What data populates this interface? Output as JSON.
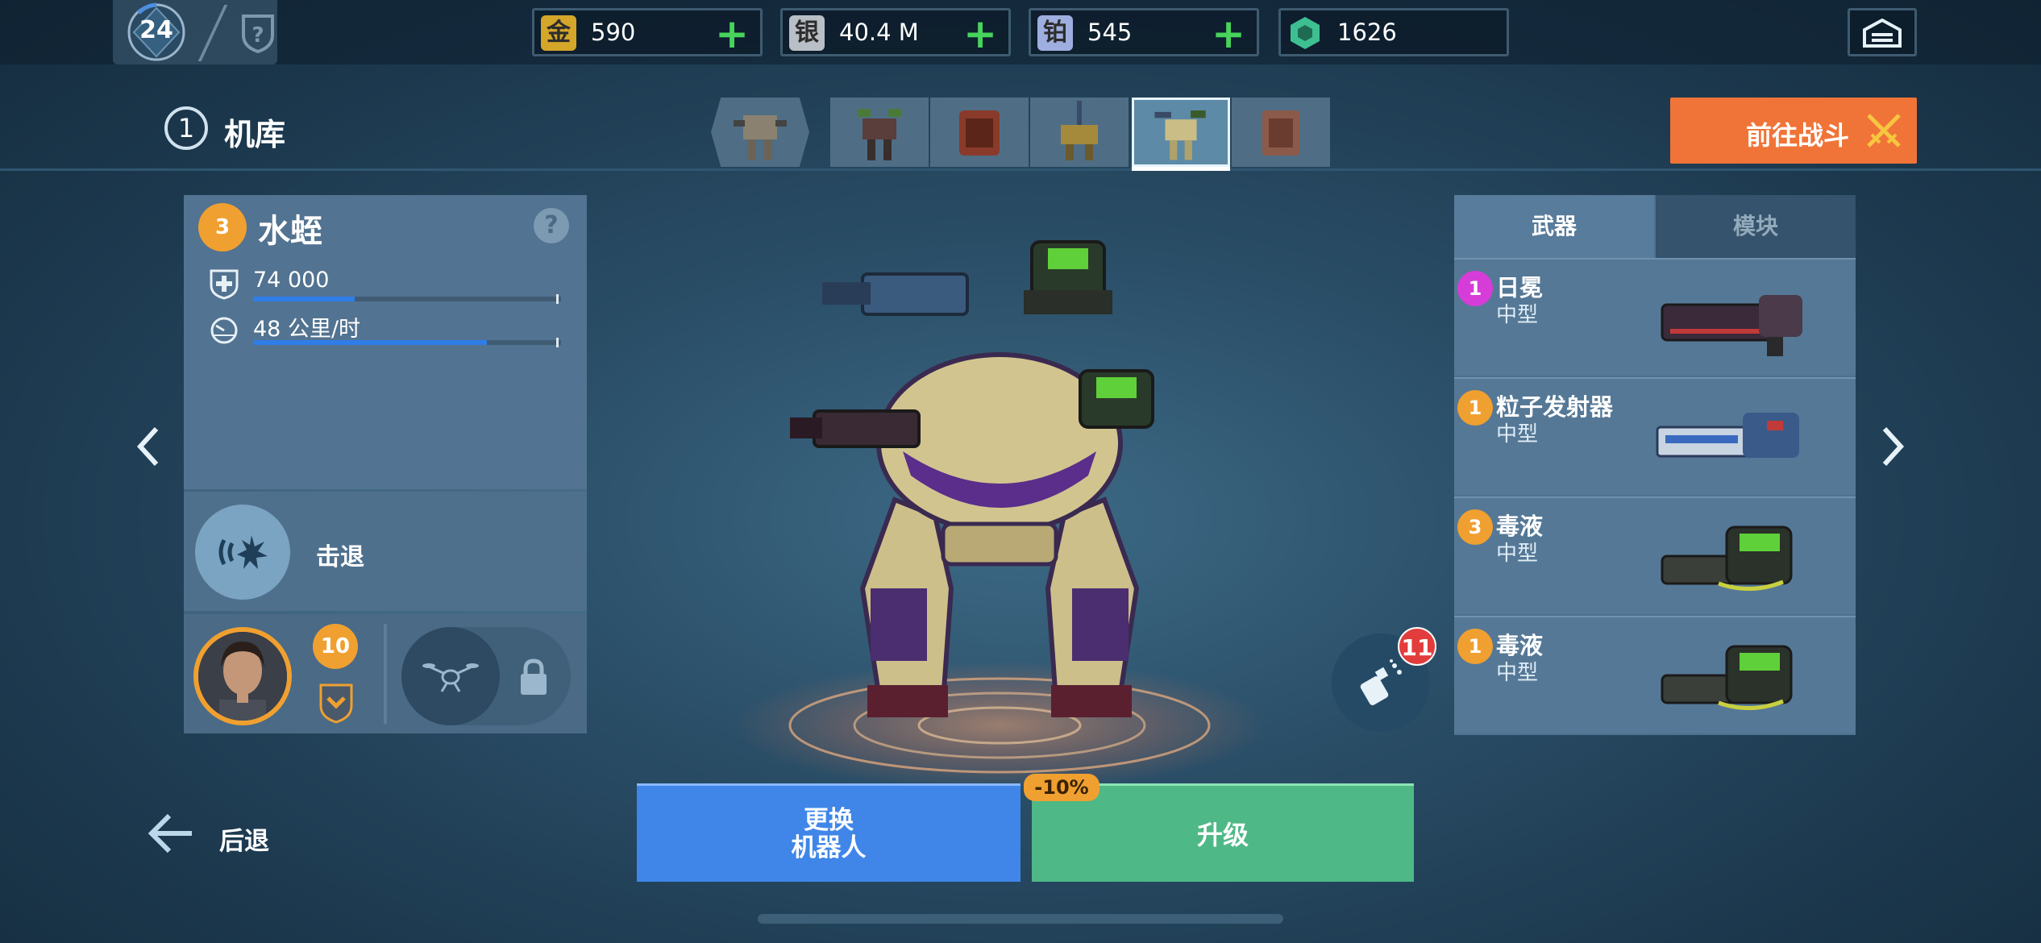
{
  "player": {
    "level": "24"
  },
  "currencies": [
    {
      "name": "gold",
      "glyph": "金",
      "value": "590",
      "color": "#d4a62a"
    },
    {
      "name": "silver",
      "glyph": "银",
      "value": "40.4 M",
      "color": "#b9bfc6"
    },
    {
      "name": "platinum",
      "glyph": "铂",
      "value": "545",
      "color": "#9eaedf"
    },
    {
      "name": "key",
      "glyph": "",
      "value": "1626",
      "color": "#3dbf91"
    }
  ],
  "header": {
    "hangar_number": "1",
    "hangar_title": "机库",
    "go_battle": "前往战斗"
  },
  "robot": {
    "rank": "3",
    "name": "水蛭",
    "stats": [
      {
        "icon": "shield-plus-icon",
        "value": "74 000",
        "fill": 0.33
      },
      {
        "icon": "speedometer-icon",
        "value": "48 公里/时",
        "fill": 0.76
      }
    ],
    "ability": "击退",
    "pilot_level": "10"
  },
  "weapons_panel": {
    "tabs": [
      "武器",
      "模块"
    ],
    "weapons": [
      {
        "badge": "1",
        "badge_color": "#d63cd8",
        "name": "日冕",
        "type": "中型"
      },
      {
        "badge": "1",
        "badge_color": "#f0a030",
        "name": "粒子发射器",
        "type": "中型"
      },
      {
        "badge": "3",
        "badge_color": "#f0a030",
        "name": "毒液",
        "type": "中型"
      },
      {
        "badge": "1",
        "badge_color": "#f0a030",
        "name": "毒液",
        "type": "中型"
      }
    ]
  },
  "spray": {
    "count": "11"
  },
  "footer": {
    "back": "后退",
    "change_line1": "更换",
    "change_line2": "机器人",
    "upgrade": "升级",
    "discount": "-10%"
  }
}
